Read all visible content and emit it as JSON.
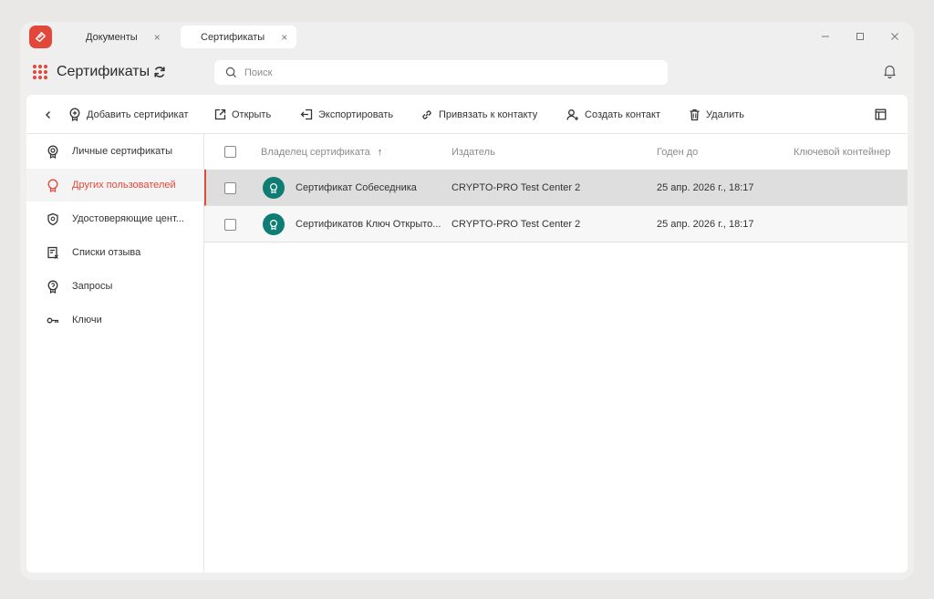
{
  "tabs": [
    {
      "label": "Документы",
      "close": "×"
    },
    {
      "label": "Сертификаты",
      "close": "×"
    }
  ],
  "window_controls": {
    "minimize": "—",
    "maximize": "☐",
    "close": "×"
  },
  "header": {
    "title": "Сертификаты"
  },
  "search": {
    "placeholder": "Поиск",
    "value": ""
  },
  "toolbar": {
    "back": "‹",
    "add": "Добавить сертификат",
    "open": "Открыть",
    "export": "Экспортировать",
    "link": "Привязать к контакту",
    "create_contact": "Создать контакт",
    "delete": "Удалить"
  },
  "sidebar": {
    "items": [
      {
        "label": "Личные сертификаты",
        "icon": "cert-icon"
      },
      {
        "label": "Других пользователей",
        "icon": "cert-outline-icon",
        "active": true
      },
      {
        "label": "Удостоверяющие цент...",
        "icon": "shield-icon"
      },
      {
        "label": "Списки отзыва",
        "icon": "revocation-list-icon"
      },
      {
        "label": "Запросы",
        "icon": "request-icon"
      },
      {
        "label": "Ключи",
        "icon": "key-icon"
      }
    ]
  },
  "table": {
    "columns": {
      "owner": "Владелец сертификата",
      "issuer": "Издатель",
      "valid_to": "Годен до",
      "container": "Ключевой контейнер"
    },
    "sort_arrow": "↑",
    "rows": [
      {
        "owner": "Сертификат Собеседника",
        "issuer": "CRYPTO-PRO Test Center 2",
        "valid_to": "25 апр. 2026 г., 18:17",
        "container": ""
      },
      {
        "owner": "Сертификатов Ключ Открыто...",
        "issuer": "CRYPTO-PRO Test Center 2",
        "valid_to": "25 апр. 2026 г., 18:17",
        "container": ""
      }
    ]
  },
  "colors": {
    "accent": "#e2483a",
    "cert_badge": "#0f7d73"
  }
}
